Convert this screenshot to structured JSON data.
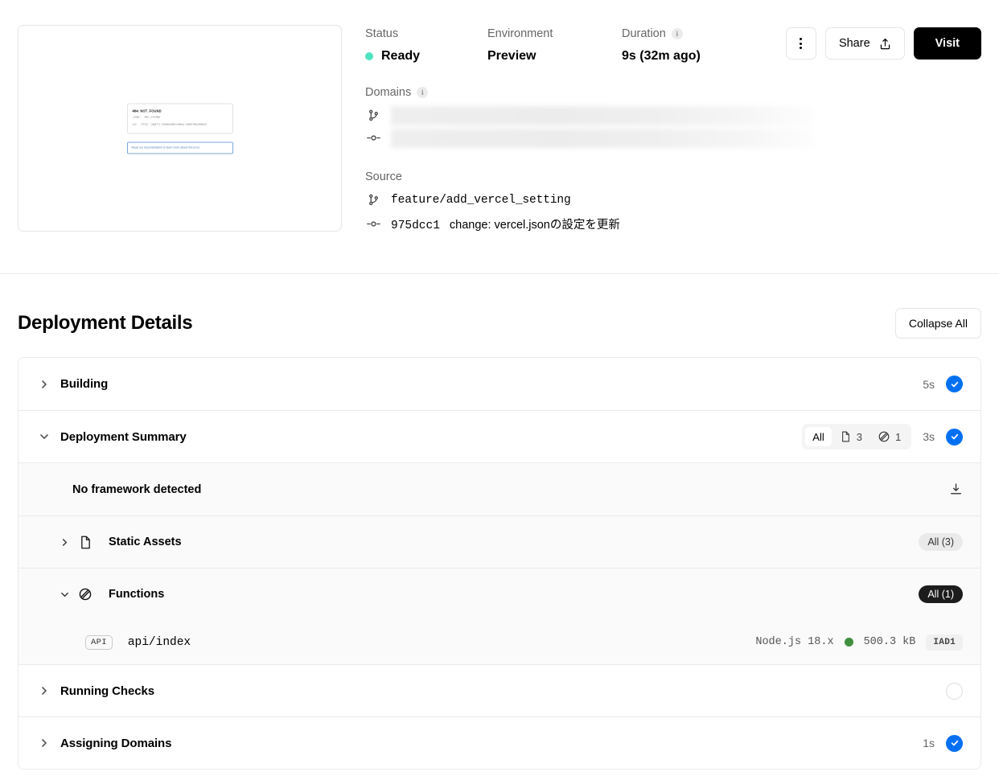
{
  "header": {
    "preview": {
      "error_title_code": "404",
      "error_title_name": ": NOT_FOUND",
      "code_line": "Code: `NOT_FOUND`",
      "id_line": "ID: `sfo1::xgxf1-1698339679052-96ef4e269b2c`",
      "cta": "Read our documentation to learn more about this error."
    },
    "status": {
      "label": "Status",
      "value": "Ready",
      "color": "#50e3c2"
    },
    "environment": {
      "label": "Environment",
      "value": "Preview"
    },
    "duration": {
      "label": "Duration",
      "value": "9s (32m ago)",
      "info": "i"
    },
    "actions": {
      "more_label": "",
      "share_label": "Share",
      "visit_label": "Visit"
    },
    "domains": {
      "label": "Domains",
      "info": "i"
    },
    "source": {
      "label": "Source",
      "branch": "feature/add_vercel_setting",
      "commit_sha": "975dcc1",
      "commit_message": "change: vercel.jsonの設定を更新"
    }
  },
  "details": {
    "title": "Deployment Details",
    "collapse_all": "Collapse All",
    "rows": {
      "building": {
        "label": "Building",
        "duration": "5s"
      },
      "summary": {
        "label": "Deployment Summary",
        "duration": "3s",
        "segments": [
          {
            "label": "All",
            "icon": "none"
          },
          {
            "label": "3",
            "icon": "file-icon"
          },
          {
            "label": "1",
            "icon": "layers-icon"
          }
        ]
      },
      "framework": {
        "label": "No framework detected"
      },
      "static_assets": {
        "label": "Static Assets",
        "badge": "All (3)"
      },
      "functions": {
        "label": "Functions",
        "badge": "All (1)"
      },
      "function_item": {
        "tag": "API",
        "name": "api/index",
        "runtime": "Node.js 18.x",
        "size": "500.3 kB",
        "region": "IAD1"
      },
      "running_checks": {
        "label": "Running Checks",
        "duration": ""
      },
      "assigning_domains": {
        "label": "Assigning Domains",
        "duration": "1s"
      }
    }
  }
}
